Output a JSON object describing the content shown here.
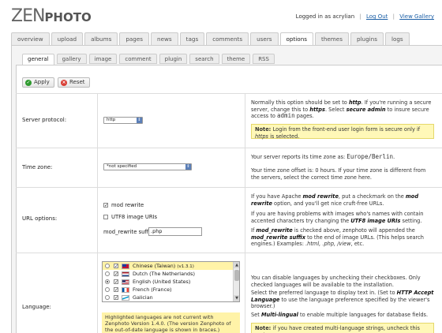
{
  "header": {
    "logo_zen": "ZEN",
    "logo_photo": "PHOTO",
    "logged_in_text": "Logged in as acrylian",
    "logout_link": "Log Out",
    "view_gallery_link": "View Gallery",
    "sep": "|"
  },
  "main_tabs": [
    {
      "label": "overview"
    },
    {
      "label": "upload"
    },
    {
      "label": "albums"
    },
    {
      "label": "pages"
    },
    {
      "label": "news"
    },
    {
      "label": "tags"
    },
    {
      "label": "comments"
    },
    {
      "label": "users"
    },
    {
      "label": "options",
      "active": true
    },
    {
      "label": "themes"
    },
    {
      "label": "plugins"
    },
    {
      "label": "logs"
    }
  ],
  "sub_tabs": [
    {
      "label": "general",
      "active": true
    },
    {
      "label": "gallery"
    },
    {
      "label": "image"
    },
    {
      "label": "comment"
    },
    {
      "label": "plugin"
    },
    {
      "label": "search"
    },
    {
      "label": "theme"
    },
    {
      "label": "RSS"
    }
  ],
  "buttons": {
    "apply": "Apply",
    "reset": "Reset"
  },
  "server_protocol": {
    "label": "Server protocol:",
    "value": "http",
    "desc_1": "Normally this option should be set to ",
    "desc_http": "http",
    "desc_2": ". If you're running a secure server, change this to ",
    "desc_https": "https",
    "desc_3": ". Select ",
    "desc_secure": "secure admin",
    "desc_4": " to insure secure access to ",
    "desc_admin": "admin",
    "desc_5": " pages.",
    "note_1": "Note: ",
    "note_2": "Login from the front-end user login form is secure only if ",
    "note_https": "https",
    "note_3": " is selected."
  },
  "time_zone": {
    "label": "Time zone:",
    "value": "*not specified",
    "desc_1": "Your server reports its time zone as: ",
    "server_tz": "Europe/Berlin",
    "desc_2": ".",
    "desc_3": "Your time zone offset is: 0 hours. If your time zone is different from the servers, select the correct time zone here."
  },
  "url_options": {
    "label": "URL options:",
    "mod_rewrite_label": "mod rewrite",
    "utf8_label": "UTF8 image URIs",
    "suffix_label": "mod_rewrite suffix:",
    "suffix_value": ".php",
    "desc_p1_a": "If you have Apache ",
    "desc_p1_b": "mod rewrite",
    "desc_p1_c": ", put a checkmark on the ",
    "desc_p1_d": "mod rewrite",
    "desc_p1_e": " option, and you'll get nice cruft-free URLs.",
    "desc_p2_a": "If you are having problems with images who's names with contain accented characters try changing the ",
    "desc_p2_b": "UTF8 image URIs",
    "desc_p2_c": " setting.",
    "desc_p3_a": "If ",
    "desc_p3_b": "mod_rewrite",
    "desc_p3_c": " is checked above, zenphoto will appended the ",
    "desc_p3_d": "mod_rewrite suffix",
    "desc_p3_e": " to the end of image URLs. (This helps search engines.) Examples: ",
    "desc_p3_f": ".html, .php, /view",
    "desc_p3_g": ", etc."
  },
  "language": {
    "label": "Language:",
    "languages": [
      {
        "name": "Chinese (Taiwan)",
        "suffix": "(v1.3.1)",
        "highlighted": true,
        "selected": false,
        "flag": "tw"
      },
      {
        "name": "Dutch (The Netherlands)",
        "highlighted": false,
        "selected": false,
        "flag": "nl"
      },
      {
        "name": "English (United States)",
        "highlighted": false,
        "selected": true,
        "flag": "us"
      },
      {
        "name": "French (France)",
        "highlighted": false,
        "selected": false,
        "flag": "fr"
      },
      {
        "name": "Galician",
        "highlighted": false,
        "selected": false,
        "flag": "gl"
      }
    ],
    "highlight_note": "Highlighted languages are not current with Zenphoto Version 1.4.0. (The version Zenphoto of the out-of-date language is shown in braces.) Please check the",
    "desc_p1": "You can disable languages by unchecking their checkboxes. Only checked languages will be available to the installation.",
    "desc_p2_a": "Select the preferred language to display text in. (Set to ",
    "desc_p2_b": "HTTP Accept Language",
    "desc_p2_c": " to use the language preference specified by the viewer's browser.)",
    "desc_p3_a": "Set ",
    "desc_p3_b": "Multi-lingual",
    "desc_p3_c": " to enable multiple languages for database fields.",
    "note_1": "Note: ",
    "note_2": "if you have created multi-language strings, uncheck this option,"
  },
  "colors": {
    "accent": "#1a5ea6",
    "note_bg": "#fff8b8",
    "highlight_bg": "#fff3a8"
  }
}
